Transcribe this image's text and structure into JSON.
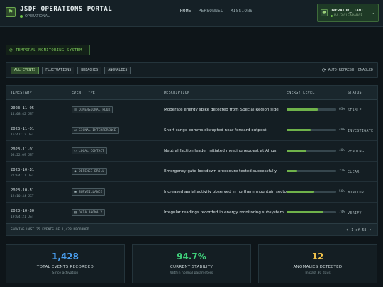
{
  "header": {
    "title": "JSDF OPERATIONS PORTAL",
    "status": "OPERATIONAL",
    "logo_icon": "shield-icon",
    "nav": [
      {
        "label": "HOME",
        "active": true
      },
      {
        "label": "PERSONNEL",
        "active": false
      },
      {
        "label": "MISSIONS",
        "active": false
      }
    ],
    "user": {
      "name": "OPERATOR_ITAMI",
      "clearance": "LVL-3 CLEARANCE",
      "avatar_icon": "user-icon",
      "chevron_icon": "chevron-down-icon"
    }
  },
  "system_badge": {
    "icon": "refresh-icon",
    "label": "TEMPORAL MONITORING SYSTEM"
  },
  "filters": {
    "buttons": [
      {
        "label": "ALL EVENTS",
        "active": true
      },
      {
        "label": "FLUCTUATIONS",
        "active": false
      },
      {
        "label": "BREACHES",
        "active": false
      },
      {
        "label": "ANOMALIES",
        "active": false
      }
    ],
    "auto_refresh": "AUTO-REFRESH: ENABLED"
  },
  "table": {
    "headers": [
      "TIMESTAMP",
      "EVENT TYPE",
      "DESCRIPTION",
      "ENERGY LEVEL",
      "STATUS"
    ],
    "rows": [
      {
        "date": "2023-11-05",
        "time": "14:08:42 JST",
        "type": "DIMENSIONAL FLUX",
        "type_icon": "chart-icon",
        "description": "Moderate energy spike detected from Special Region side",
        "energy": 63,
        "energy_label": "63%",
        "status": "STABLE"
      },
      {
        "date": "2023-11-01",
        "time": "16:47:12 JST",
        "type": "SIGNAL INTERFERENCE",
        "type_icon": "signal-icon",
        "description": "Short-range comms disrupted near forward outpost",
        "energy": 48,
        "energy_label": "48%",
        "status": "INVESTIGATE"
      },
      {
        "date": "2023-11-01",
        "time": "08:22:09 JST",
        "type": "LOCAL CONTACT",
        "type_icon": "people-icon",
        "description": "Neutral faction leader initiated meeting request at Alnus",
        "energy": 40,
        "energy_label": "40%",
        "status": "PENDING"
      },
      {
        "date": "2023-10-31",
        "time": "22:04:11 JST",
        "type": "DEFENSE DRILL",
        "type_icon": "shield-icon",
        "description": "Emergency gate lockdown procedure tested successfully",
        "energy": 22,
        "energy_label": "22%",
        "status": "CLEAR"
      },
      {
        "date": "2023-10-31",
        "time": "12:10:44 JST",
        "type": "SURVEILLANCE",
        "type_icon": "eye-icon",
        "description": "Increased aerial activity observed in northern mountain sector",
        "energy": 56,
        "energy_label": "56%",
        "status": "MONITOR"
      },
      {
        "date": "2023-10-30",
        "time": "19:04:21 JST",
        "type": "DATA ANOMALY",
        "type_icon": "database-icon",
        "description": "Irregular readings recorded in energy monitoring subsystem",
        "energy": 74,
        "energy_label": "74%",
        "status": "VERIFY"
      }
    ],
    "footer": "SHOWING LAST 25 EVENTS OF 1,428 RECORDED",
    "pagination": "1 of 58"
  },
  "stats": [
    {
      "value": "1,428",
      "label": "TOTAL EVENTS RECORDED",
      "sub": "Since activation",
      "color": "#4a9ff0"
    },
    {
      "value": "94.7%",
      "label": "CURRENT STABILITY",
      "sub": "Within normal parameters",
      "color": "#3fcf7a"
    },
    {
      "value": "12",
      "label": "ANOMALIES DETECTED",
      "sub": "In past 30 days",
      "color": "#f0c24a"
    }
  ]
}
